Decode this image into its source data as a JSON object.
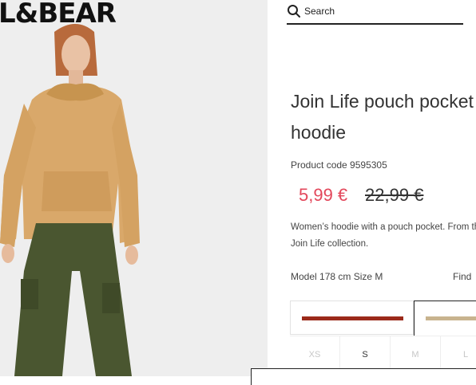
{
  "brand": {
    "logo_text": "L&BEAR"
  },
  "search": {
    "label": "Search",
    "icon": "search-icon"
  },
  "product": {
    "title_line1": "Join Life pouch pocket",
    "title_line2": "hoodie",
    "code": "Product code 9595305",
    "price_current": "5,99 €",
    "price_old": "22,99 €",
    "description_line1": "Women’s hoodie with a pouch pocket. From the",
    "description_line2": "Join Life collection.",
    "model_info": "Model 178 cm Size M",
    "find_link": "Find"
  },
  "colors": [
    {
      "name": "rust",
      "hex": "#9b2a1a",
      "selected": false
    },
    {
      "name": "camel",
      "hex": "#c8b38e",
      "selected": true
    }
  ],
  "sizes": [
    {
      "label": "XS",
      "available": false
    },
    {
      "label": "S",
      "available": true
    },
    {
      "label": "M",
      "available": false
    },
    {
      "label": "L",
      "available": false
    }
  ],
  "theme": {
    "price_sale_color": "#e3475b",
    "text_color": "#222222"
  }
}
